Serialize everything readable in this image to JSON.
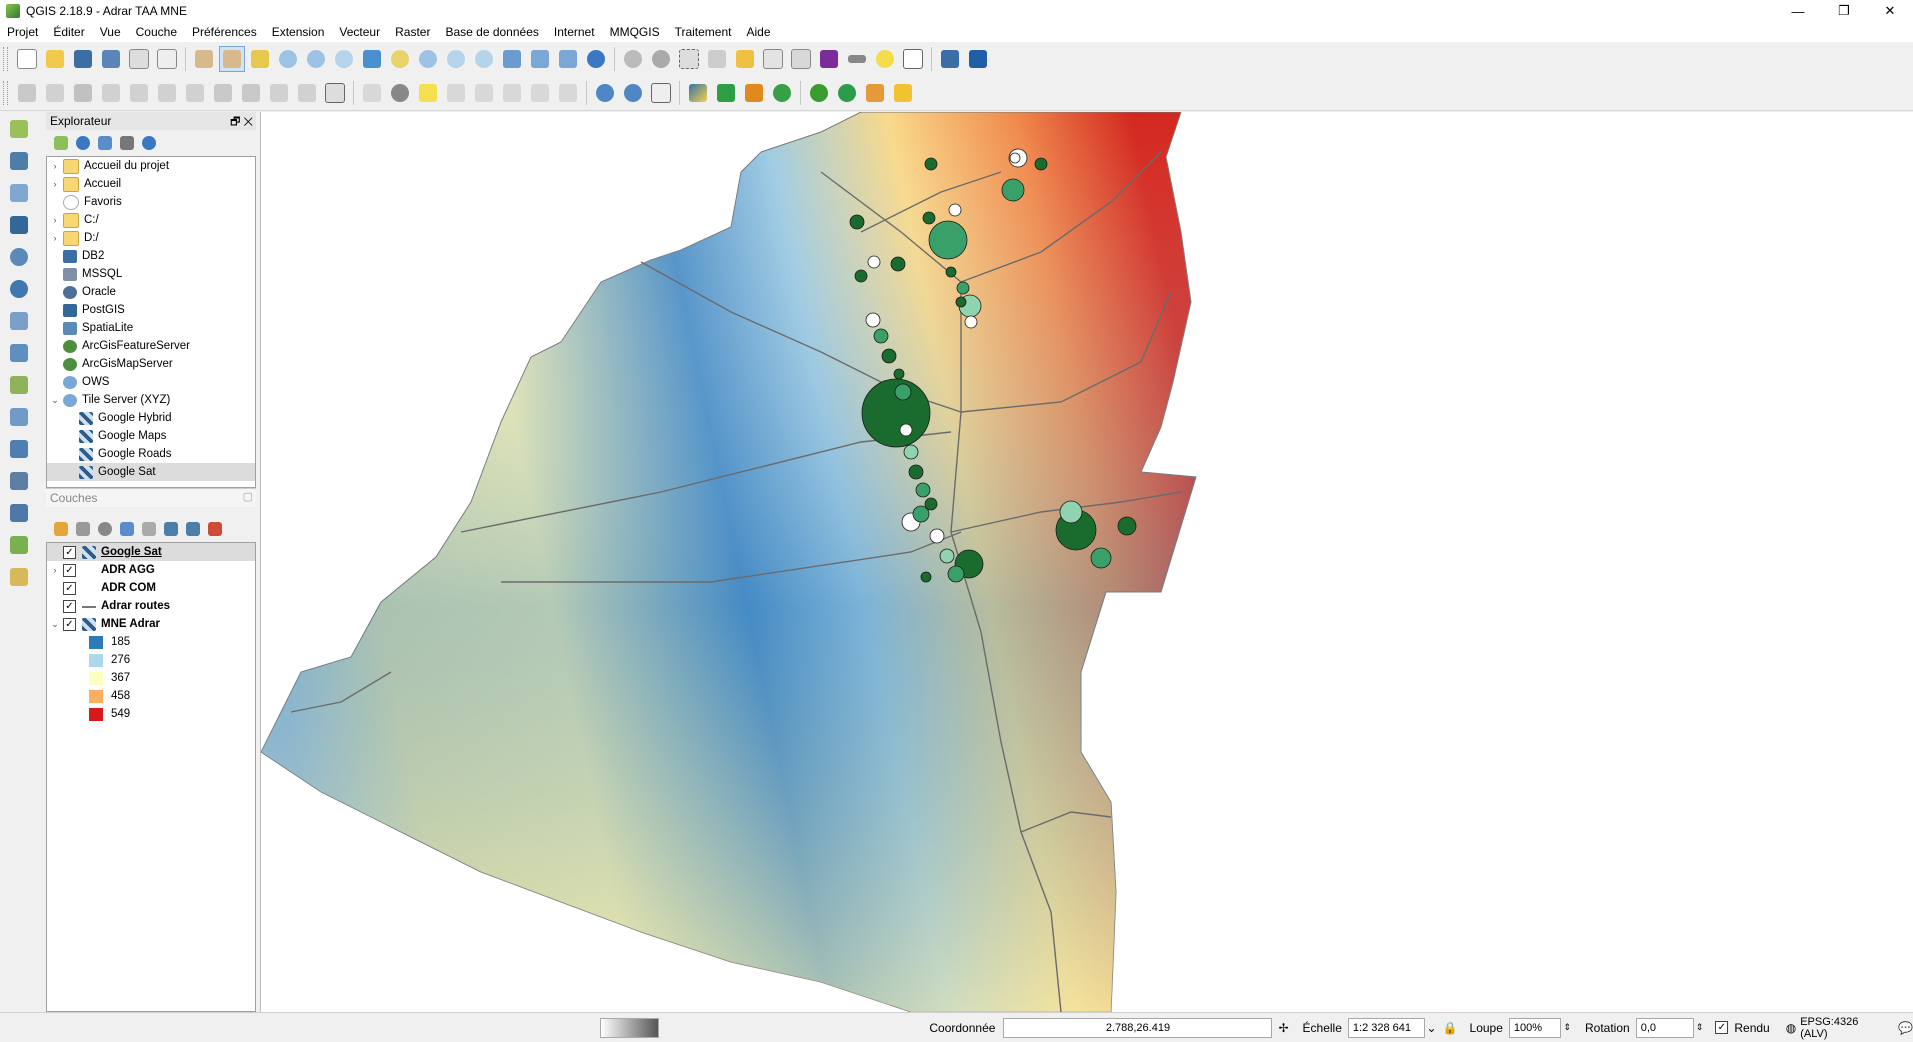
{
  "window": {
    "title": "QGIS 2.18.9 - Adrar TAA MNE",
    "controls": [
      "—",
      "❐",
      "✕"
    ]
  },
  "menu": [
    "Projet",
    "Éditer",
    "Vue",
    "Couche",
    "Préférences",
    "Extension",
    "Vecteur",
    "Raster",
    "Base de données",
    "Internet",
    "MMQGIS",
    "Traitement",
    "Aide"
  ],
  "browser": {
    "title": "Explorateur",
    "items": [
      {
        "label": "Accueil du projet",
        "icon": "folder-icon",
        "expand": "›",
        "indent": 0
      },
      {
        "label": "Accueil",
        "icon": "folder-icon",
        "expand": "›",
        "indent": 0
      },
      {
        "label": "Favoris",
        "icon": "star-icon",
        "expand": "",
        "indent": 0
      },
      {
        "label": "C:/",
        "icon": "folder-icon",
        "expand": "›",
        "indent": 0
      },
      {
        "label": "D:/",
        "icon": "folder-icon",
        "expand": "›",
        "indent": 0
      },
      {
        "label": "DB2",
        "icon": "db2-icon",
        "expand": "",
        "indent": 0
      },
      {
        "label": "MSSQL",
        "icon": "mssql-icon",
        "expand": "",
        "indent": 0
      },
      {
        "label": "Oracle",
        "icon": "oracle-icon",
        "expand": "",
        "indent": 0
      },
      {
        "label": "PostGIS",
        "icon": "postgis-icon",
        "expand": "",
        "indent": 0
      },
      {
        "label": "SpatiaLite",
        "icon": "spatialite-icon",
        "expand": "",
        "indent": 0
      },
      {
        "label": "ArcGisFeatureServer",
        "icon": "arcgis-icon",
        "expand": "",
        "indent": 0
      },
      {
        "label": "ArcGisMapServer",
        "icon": "arcgis-icon",
        "expand": "",
        "indent": 0
      },
      {
        "label": "OWS",
        "icon": "globe-icon",
        "expand": "",
        "indent": 0
      },
      {
        "label": "Tile Server (XYZ)",
        "icon": "globe-icon",
        "expand": "⌄",
        "indent": 0
      },
      {
        "label": "Google Hybrid",
        "icon": "tile-icon",
        "expand": "",
        "indent": 1
      },
      {
        "label": "Google Maps",
        "icon": "tile-icon",
        "expand": "",
        "indent": 1
      },
      {
        "label": "Google Roads",
        "icon": "tile-icon",
        "expand": "",
        "indent": 1
      },
      {
        "label": "Google Sat",
        "icon": "tile-icon",
        "expand": "",
        "indent": 1,
        "selected": true
      }
    ]
  },
  "layers": {
    "title": "Couches",
    "items": [
      {
        "label": "Google Sat",
        "expand": "",
        "underline": true
      },
      {
        "label": "ADR AGG",
        "expand": "›"
      },
      {
        "label": "ADR COM",
        "expand": ""
      },
      {
        "label": "Adrar routes",
        "expand": ""
      },
      {
        "label": "MNE Adrar",
        "expand": "⌄"
      }
    ],
    "legend": [
      {
        "label": "185",
        "color": "#2c7bb6"
      },
      {
        "label": "276",
        "color": "#abd9e9"
      },
      {
        "label": "367",
        "color": "#ffffbf"
      },
      {
        "label": "458",
        "color": "#fdae61"
      },
      {
        "label": "549",
        "color": "#d7191c"
      }
    ]
  },
  "status": {
    "coord_label": "Coordonnée",
    "coord_value": "2.788,26.419",
    "scale_label": "Échelle",
    "scale_value": "1:2 328 641",
    "zoom_label": "Loupe",
    "zoom_value": "100%",
    "rotation_label": "Rotation",
    "rotation_value": "0,0",
    "render_label": "Rendu",
    "crs": "EPSG:4326 (ALV)"
  },
  "colors": {
    "accent": "#3a78c4",
    "points_dark": "#1a6b2e",
    "points_mid": "#3aa06a",
    "points_light": "#8fd3b0"
  }
}
